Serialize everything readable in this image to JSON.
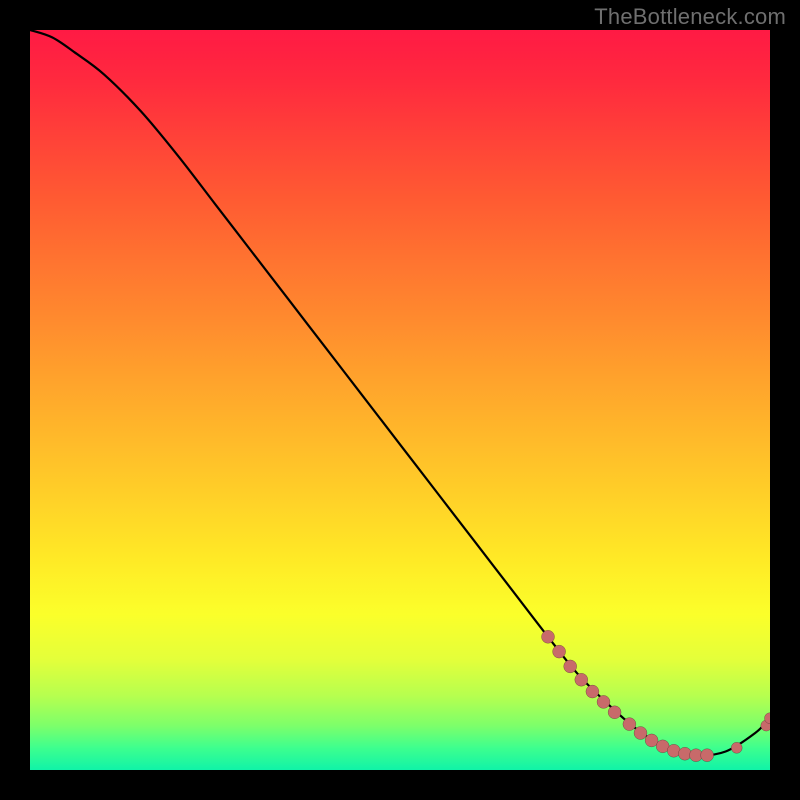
{
  "watermark": "TheBottleneck.com",
  "chart_data": {
    "type": "line",
    "title": "",
    "xlabel": "",
    "ylabel": "",
    "xlim": [
      0,
      100
    ],
    "ylim": [
      0,
      100
    ],
    "grid": false,
    "legend": false,
    "series": [
      {
        "name": "curve",
        "x": [
          0,
          3,
          6,
          10,
          15,
          20,
          25,
          30,
          35,
          40,
          45,
          50,
          55,
          60,
          65,
          70,
          74,
          78,
          82,
          86,
          90,
          94,
          98,
          100
        ],
        "y": [
          100,
          99,
          97,
          94,
          89,
          83,
          76.5,
          70,
          63.5,
          57,
          50.5,
          44,
          37.5,
          31,
          24.5,
          18,
          13,
          9,
          5.5,
          3,
          2,
          2.5,
          5,
          7
        ],
        "note": "y is percentage of vertical axis (0 at bottom, 100 at top). Values estimated from pixels."
      }
    ],
    "markers": [
      {
        "group": "upper-cluster",
        "points": [
          {
            "x": 70,
            "y": 18
          },
          {
            "x": 71.5,
            "y": 16
          },
          {
            "x": 73,
            "y": 14
          },
          {
            "x": 74.5,
            "y": 12.2
          },
          {
            "x": 76,
            "y": 10.6
          },
          {
            "x": 77.5,
            "y": 9.2
          },
          {
            "x": 79,
            "y": 7.8
          }
        ]
      },
      {
        "group": "lower-cluster",
        "points": [
          {
            "x": 81,
            "y": 6.2
          },
          {
            "x": 82.5,
            "y": 5.0
          },
          {
            "x": 84,
            "y": 4.0
          },
          {
            "x": 85.5,
            "y": 3.2
          },
          {
            "x": 87,
            "y": 2.6
          },
          {
            "x": 88.5,
            "y": 2.2
          },
          {
            "x": 90,
            "y": 2.0
          },
          {
            "x": 91.5,
            "y": 2.0
          }
        ]
      },
      {
        "group": "trailing",
        "points": [
          {
            "x": 95.5,
            "y": 3.0
          },
          {
            "x": 99.5,
            "y": 6.0
          },
          {
            "x": 100,
            "y": 7.0
          }
        ]
      }
    ]
  },
  "colors": {
    "background": "#000000",
    "watermark_text": "#6f6f6f",
    "marker": "#c86a6a",
    "curve": "#000000"
  }
}
